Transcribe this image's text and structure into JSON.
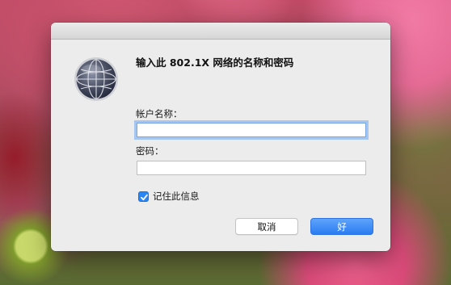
{
  "dialog": {
    "prompt": "输入此 802.1X 网络的名称和密码",
    "account_label": "帐户名称：",
    "account_value": "",
    "password_label": "密码：",
    "password_value": "",
    "remember_label": "记住此信息",
    "remember_checked": true,
    "cancel_label": "取消",
    "ok_label": "好",
    "icon": "network-globe-icon"
  },
  "colors": {
    "accent": "#2a86f4",
    "dialog_bg": "#ececec"
  }
}
